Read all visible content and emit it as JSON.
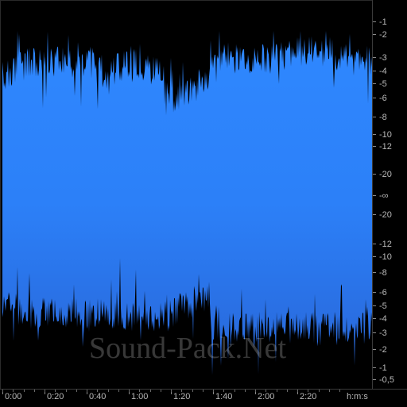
{
  "colors": {
    "waveform_top": "#2d86ff",
    "waveform_bottom": "#2a70e0",
    "background": "#000000"
  },
  "db_scale": {
    "unit": "dB",
    "labels": [
      "-1",
      "-2",
      "-3",
      "-4",
      "-5",
      "-6",
      "-8",
      "-10",
      "-12",
      "-20",
      "-∞",
      "-20",
      "-12",
      "-10",
      "-8",
      "-6",
      "-5",
      "-4",
      "-3",
      "-2",
      "-1",
      "-0,5"
    ]
  },
  "time_ruler": {
    "unit": "h:m:s",
    "labels": [
      "0:00",
      "0:20",
      "0:40",
      "1:00",
      "1:20",
      "1:40",
      "2:00",
      "2:20"
    ]
  },
  "watermark": "Sound-Pack.Net"
}
